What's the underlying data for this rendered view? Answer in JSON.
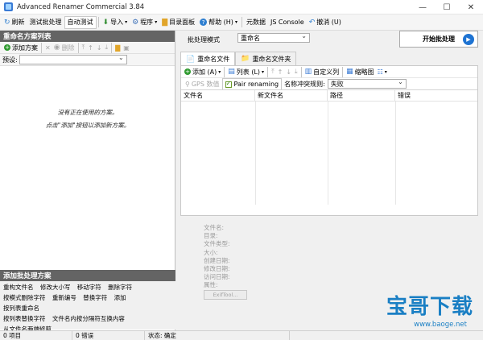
{
  "window": {
    "title": "Advanced Renamer Commercial 3.84",
    "controls": [
      "—",
      "☐",
      "✕"
    ]
  },
  "toolbar": {
    "items": [
      {
        "name": "refresh",
        "label": "刷新",
        "icon": "↻"
      },
      {
        "name": "test-batch",
        "label": "测试批处理",
        "icon": ""
      },
      {
        "name": "auto-test",
        "label": "自动测试",
        "icon": ""
      },
      {
        "name": "import",
        "label": "导入",
        "icon": "⬇"
      },
      {
        "name": "program",
        "label": "程序",
        "icon": "⚙"
      },
      {
        "name": "directory-panel",
        "label": "目录面板",
        "icon": "▇"
      },
      {
        "name": "help",
        "label": "帮助 (H)",
        "icon": "?"
      },
      {
        "name": "metadata",
        "label": "元数据",
        "icon": ""
      },
      {
        "name": "js-console",
        "label": "JS Console",
        "icon": ""
      },
      {
        "name": "undo",
        "label": "撤消 (U)",
        "icon": "↶"
      }
    ]
  },
  "left": {
    "header": "重命名方案列表",
    "toolbar": {
      "add": "添加方案",
      "delete": "删除"
    },
    "preset_label": "预设:",
    "empty_line1": "没有正在使用的方案。",
    "empty_line2": "点击\"添加\"按钮以添加新方案。",
    "batch_header": "添加批处理方案",
    "batch_methods": [
      [
        "重构文件名",
        "修改大小写",
        "移动字符",
        "删除字符"
      ],
      [
        "按模式删除字符",
        "重新编号",
        "替换字符",
        "添加",
        "按列表重命名"
      ],
      [
        "按列表替换字符",
        "文件名内按分隔符互换内容"
      ],
      [
        "从文件名两端修剪"
      ]
    ]
  },
  "right": {
    "batch_mode_label": "批处理模式",
    "batch_mode_value": "重命名",
    "start_button": "开始批处理",
    "tabs": [
      {
        "label": "重命名文件",
        "icon": "📄"
      },
      {
        "label": "重命名文件夹",
        "icon": "📁"
      }
    ],
    "file_toolbar": {
      "add": "添加 (A)",
      "list": "列表 (L)",
      "custom_columns": "自定义列",
      "thumbnail": "缩略图"
    },
    "subtabs": {
      "gps": "GPS 数值",
      "pair": "Pair renaming",
      "conflict_label": "名称冲突规则:",
      "conflict_value": "失败"
    },
    "columns": [
      "文件名",
      "新文件名",
      "路径",
      "错误"
    ],
    "props": [
      "文件名:",
      "目录:",
      "文件类型:",
      "大小:",
      "创建日期:",
      "修改日期:",
      "访问日期:",
      "属性:"
    ],
    "exif_button": "ExifTool..."
  },
  "statusbar": {
    "items": "0 项目",
    "errors": "0 错误",
    "status": "状态: 确定"
  },
  "watermark": {
    "text": "宝哥下载",
    "url": "www.baoge.net"
  }
}
